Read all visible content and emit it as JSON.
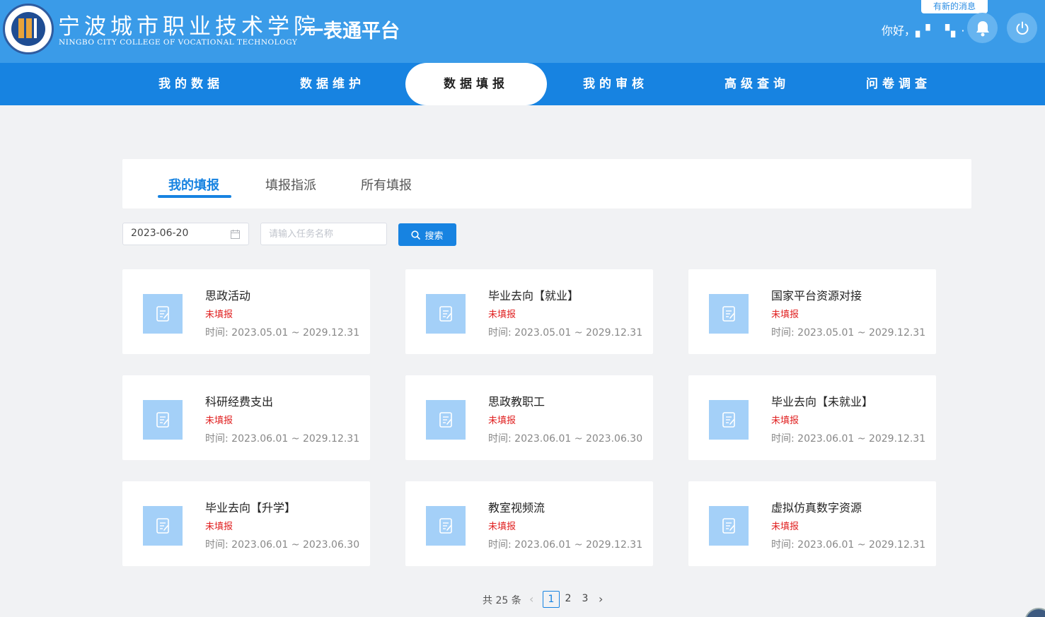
{
  "header": {
    "school_name_cn": "宁波城市职业技术学院",
    "school_name_en": "NINGBO CITY COLLEGE OF VOCATIONAL TECHNOLOGY",
    "platform_title": "一表通平台",
    "greeting": "你好，",
    "new_message_badge": "有新的消息"
  },
  "nav": {
    "items": [
      {
        "label": "我的数据"
      },
      {
        "label": "数据维护"
      },
      {
        "label": "数据填报",
        "active": true
      },
      {
        "label": "我的审核"
      },
      {
        "label": "高级查询"
      },
      {
        "label": "问卷调查"
      }
    ]
  },
  "tabs": [
    {
      "label": "我的填报",
      "active": true
    },
    {
      "label": "填报指派"
    },
    {
      "label": "所有填报"
    }
  ],
  "filters": {
    "date_value": "2023-06-20",
    "task_placeholder": "请输入任务名称",
    "search_label": "搜索"
  },
  "cards": [
    {
      "title": "思政活动",
      "status": "未填报",
      "time": "时间: 2023.05.01 ~ 2029.12.31"
    },
    {
      "title": "毕业去向【就业】",
      "status": "未填报",
      "time": "时间: 2023.05.01 ~ 2029.12.31"
    },
    {
      "title": "国家平台资源对接",
      "status": "未填报",
      "time": "时间: 2023.05.01 ~ 2029.12.31"
    },
    {
      "title": "科研经费支出",
      "status": "未填报",
      "time": "时间: 2023.06.01 ~ 2029.12.31"
    },
    {
      "title": "思政教职工",
      "status": "未填报",
      "time": "时间: 2023.06.01 ~ 2023.06.30"
    },
    {
      "title": "毕业去向【未就业】",
      "status": "未填报",
      "time": "时间: 2023.06.01 ~ 2029.12.31"
    },
    {
      "title": "毕业去向【升学】",
      "status": "未填报",
      "time": "时间: 2023.06.01 ~ 2023.06.30"
    },
    {
      "title": "教室视频流",
      "status": "未填报",
      "time": "时间: 2023.06.01 ~ 2029.12.31"
    },
    {
      "title": "虚拟仿真数字资源",
      "status": "未填报",
      "time": "时间: 2023.06.01 ~ 2029.12.31"
    }
  ],
  "pagination": {
    "total_text": "共 25 条",
    "pages": [
      "1",
      "2",
      "3"
    ],
    "current_page": "1"
  },
  "colors": {
    "header_bg": "#3a9be8",
    "nav_bg": "#1783e1",
    "accent": "#1783e1",
    "status_red": "#e02020",
    "card_icon_bg": "#a4d0f8"
  }
}
